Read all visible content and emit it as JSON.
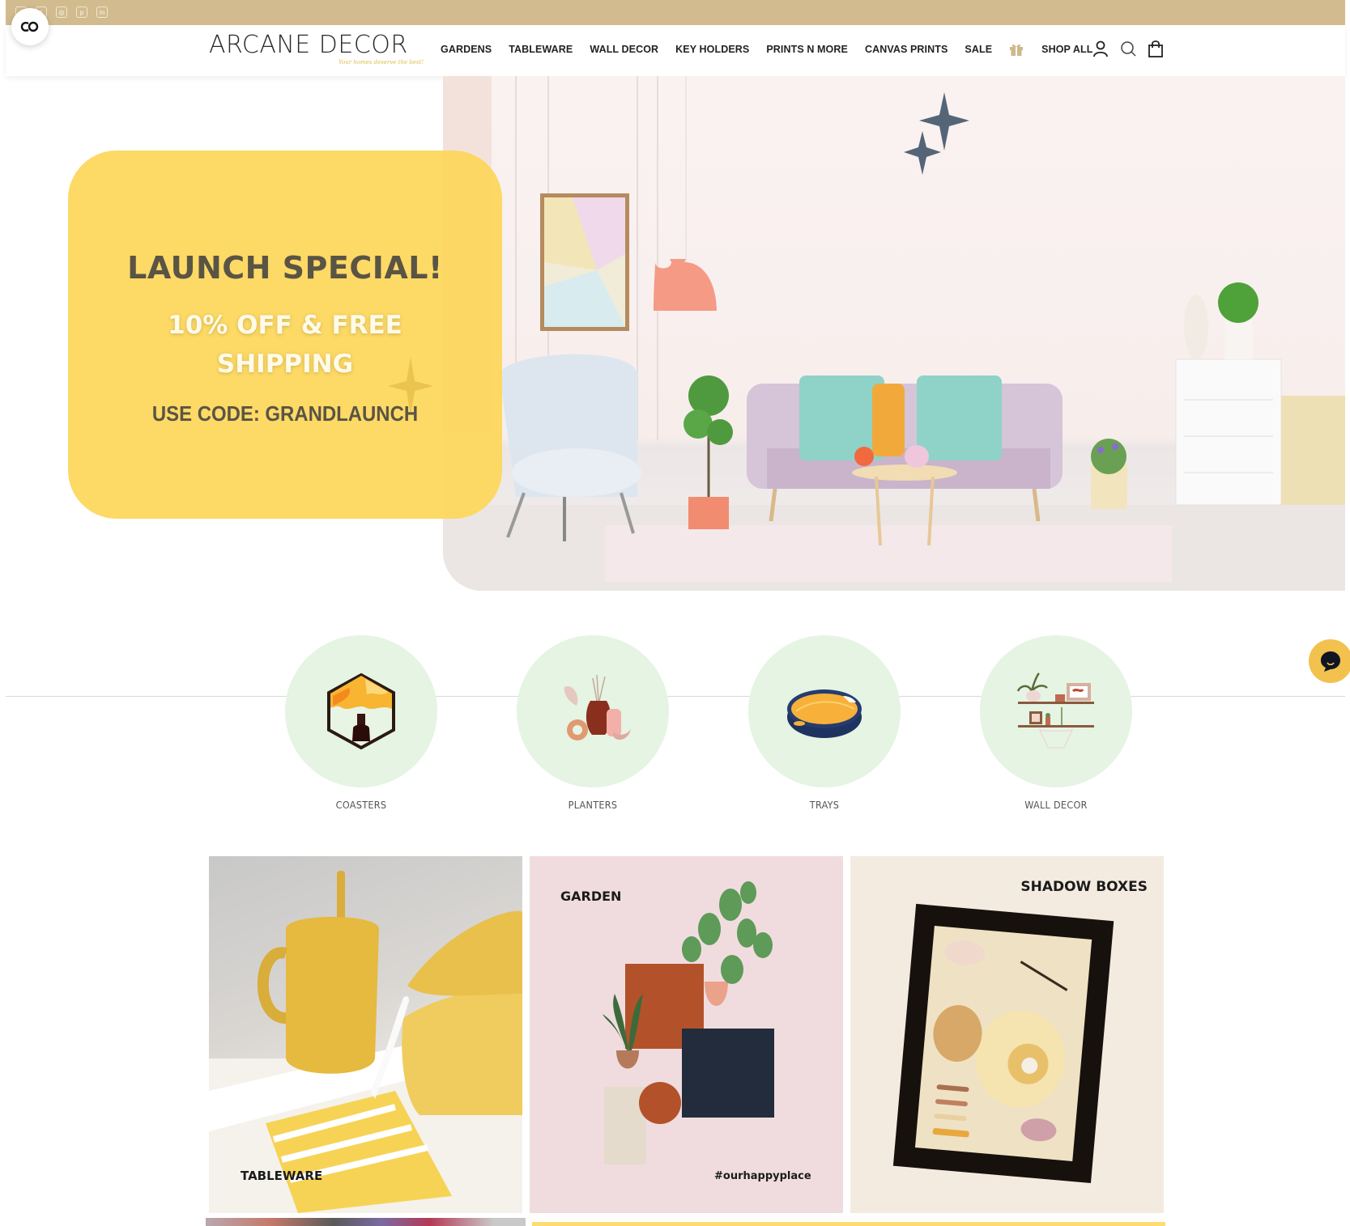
{
  "topbar": {
    "social_icons": [
      "facebook-icon",
      "twitter-icon",
      "instagram-icon",
      "pinterest-icon",
      "linkedin-icon"
    ],
    "bg_color": "#d2bb8e"
  },
  "accessibility_button": {
    "icon": "accessibility-icon"
  },
  "header": {
    "logo": "ARCANE DECOR",
    "tagline": "Your homes deserve the best!",
    "nav": [
      {
        "label": "GARDENS"
      },
      {
        "label": "TABLEWARE"
      },
      {
        "label": "WALL DECOR"
      },
      {
        "label": "KEY HOLDERS"
      },
      {
        "label": "PRINTS N MORE"
      },
      {
        "label": "CANVAS PRINTS"
      },
      {
        "label": "SALE"
      },
      {
        "icon": "gift-icon"
      },
      {
        "label": "SHOP ALL"
      }
    ],
    "icons": [
      "account-icon",
      "search-icon",
      "cart-icon"
    ]
  },
  "hero": {
    "promo_title": "LAUNCH SPECIAL!",
    "promo_sub_line1": "10% OFF & FREE",
    "promo_sub_line2": "SHIPPING",
    "promo_code": "USE CODE: GRANDLAUNCH",
    "promo_color": "#fdd65a"
  },
  "categories": [
    {
      "label": "COASTERS",
      "icon": "coaster-icon"
    },
    {
      "label": "PLANTERS",
      "icon": "planters-icon"
    },
    {
      "label": "TRAYS",
      "icon": "tray-icon"
    },
    {
      "label": "WALL DECOR",
      "icon": "wall-shelf-icon"
    }
  ],
  "tiles": [
    {
      "label": "TABLEWARE"
    },
    {
      "label": "GARDEN",
      "caption": "#ourhappyplace"
    },
    {
      "label": "SHADOW BOXES"
    }
  ],
  "chat": {
    "icon": "chat-icon",
    "color": "#f2c14e"
  }
}
